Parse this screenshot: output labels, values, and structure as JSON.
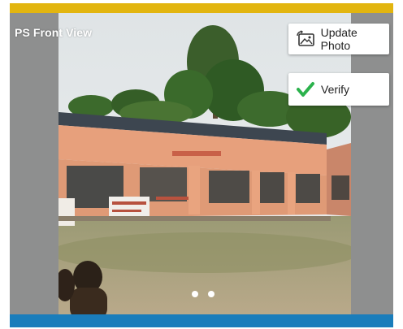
{
  "header": {
    "accent_color": "#e2b50f"
  },
  "photo_card": {
    "label": "PS Front View",
    "update_button": {
      "label": "Update Photo",
      "icon": "photo-update-icon"
    },
    "verify_button": {
      "label": "Verify",
      "icon": "check-icon",
      "icon_color": "#2bb24c"
    },
    "pager": {
      "count": 2,
      "active": 0
    }
  },
  "footer": {
    "bar_color": "#1a7dbb"
  }
}
